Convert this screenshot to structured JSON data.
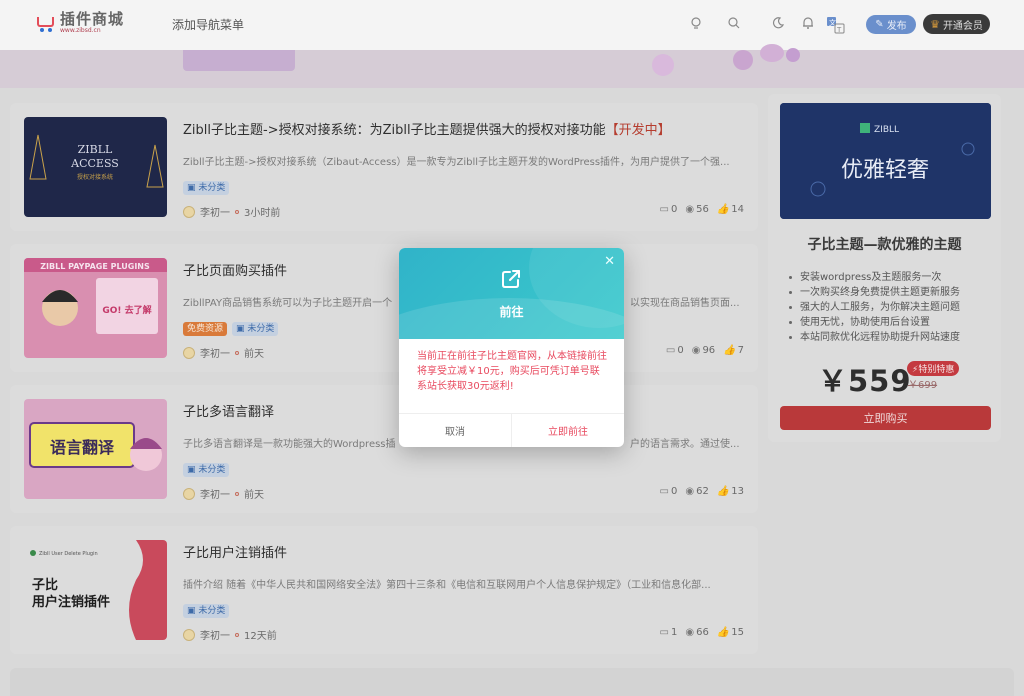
{
  "header": {
    "logo_title": "插件商城",
    "logo_sub": "www.zibsd.cn",
    "nav_label": "添加导航菜单",
    "publish_label": "发布",
    "vip_label": "开通会员"
  },
  "posts": [
    {
      "title": "Zibll子比主题->授权对接系统：为Zibll子比主题提供强大的授权对接功能",
      "tag": "【开发中】",
      "desc": "Zibll子比主题->授权对接系统（Zibaut-Access）是一款专为Zibll子比主题开发的WordPress插件，为用户提供了一个强...",
      "badges": [
        "未分类"
      ],
      "author": "李初一",
      "time": "3小时前",
      "comments": "0",
      "views": "56",
      "likes": "14",
      "thumb_text": [
        "ZIBLL",
        "ACCESS",
        "授权对接系统"
      ]
    },
    {
      "title": "子比页面购买插件",
      "tag": "",
      "desc": "ZibllPAY商品销售系统可以为子比主题开启一个",
      "desc2": "以实现在商品销售页面...",
      "badges": [
        "免费资源",
        "未分类"
      ],
      "author": "李初一",
      "time": "前天",
      "comments": "0",
      "views": "96",
      "likes": "7",
      "thumb_text": [
        "ZIBLL PAYPAGE PLUGINS",
        "GO! 去了解"
      ]
    },
    {
      "title": "子比多语言翻译",
      "tag": "",
      "desc": "子比多语言翻译是一款功能强大的Wordpress插",
      "desc2": "户的语言需求。通过使...",
      "badges": [
        "未分类"
      ],
      "author": "李初一",
      "time": "前天",
      "comments": "0",
      "views": "62",
      "likes": "13",
      "thumb_text": [
        "语言翻译"
      ]
    },
    {
      "title": "子比用户注销插件",
      "tag": "",
      "desc": "插件介绍 随着《中华人民共和国网络安全法》第四十三条和《电信和互联网用户个人信息保护规定》（工业和信息化部...",
      "badges": [
        "未分类"
      ],
      "author": "李初一",
      "time": "12天前",
      "comments": "1",
      "views": "66",
      "likes": "15",
      "thumb_text": [
        "Zibll User Delete Plugin",
        "子比",
        "用户注销插件"
      ]
    }
  ],
  "sidebar": {
    "img_brand": "ZIBLL",
    "img_slogan": "优雅轻奢",
    "title": "子比主题—款优雅的主题",
    "items": [
      "安装wordpress及主题服务一次",
      "一次购买终身免费提供主题更新服务",
      "强大的人工服务，为你解决主题问题",
      "使用无忧，协助使用后台设置",
      "本站同款优化远程协助提升网站速度"
    ],
    "price": "￥559",
    "price_tag": "特别特惠",
    "old_price": "￥699",
    "buy_label": "立即购买"
  },
  "modal": {
    "title": "前往",
    "text": "当前正在前往子比主题官网，从本链接前往将享受立减￥10元，购买后可凭订单号联系站长获取30元返利!",
    "cancel_label": "取消",
    "go_label": "立即前往"
  },
  "colors": {
    "accent": "#e84a5f",
    "modal_teal": "#30b3c9"
  }
}
